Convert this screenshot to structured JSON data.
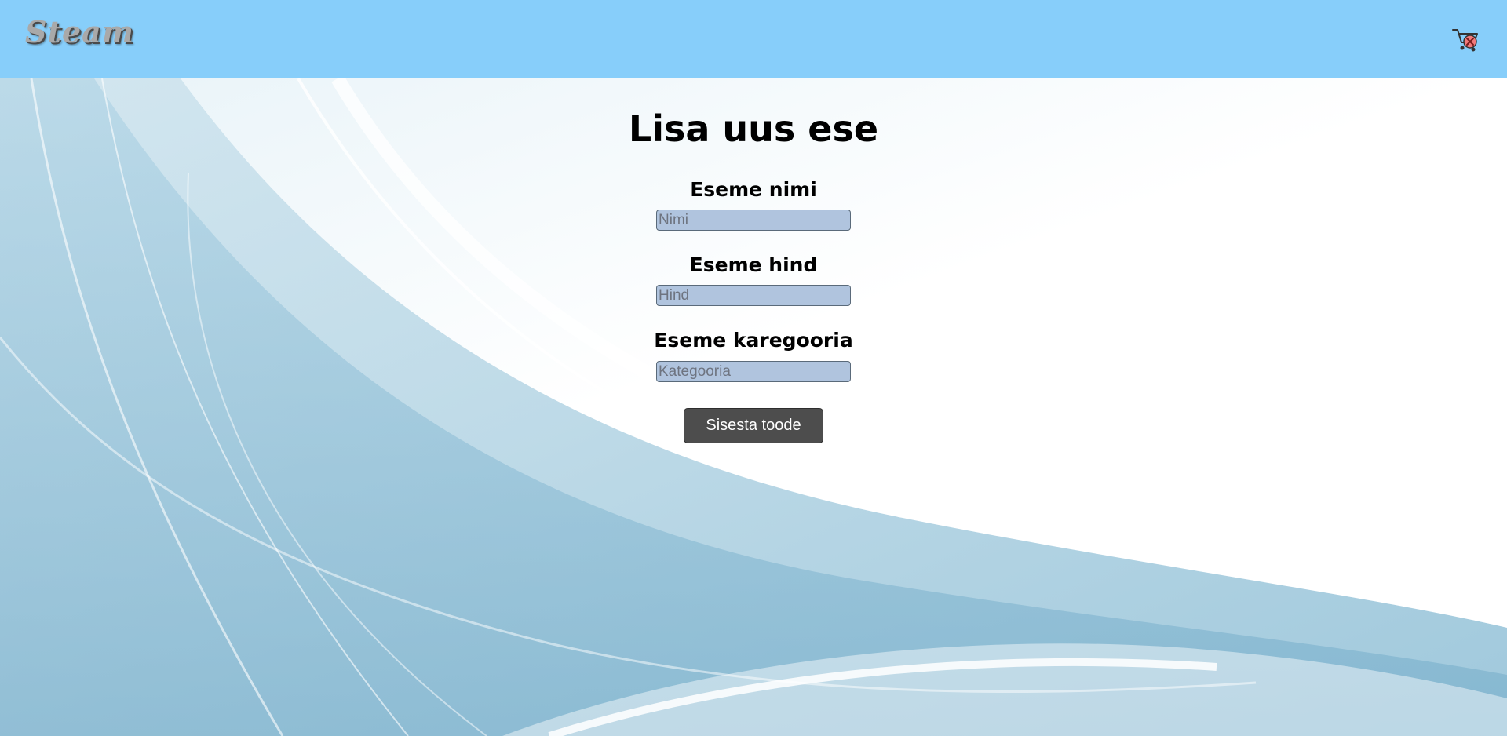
{
  "header": {
    "logo_text": "Steam",
    "cart_icon": "cart-icon",
    "background_color": "#87cefa"
  },
  "form": {
    "title": "Lisa uus ese",
    "fields": [
      {
        "label": "Eseme nimi",
        "placeholder": "Nimi",
        "value": ""
      },
      {
        "label": "Eseme hind",
        "placeholder": "Hind",
        "value": ""
      },
      {
        "label": "Eseme karegooria",
        "placeholder": "Kategooria",
        "value": ""
      }
    ],
    "submit_label": "Sisesta toode",
    "input_color": "#b0c4de",
    "button_color": "#4d4d4d"
  }
}
